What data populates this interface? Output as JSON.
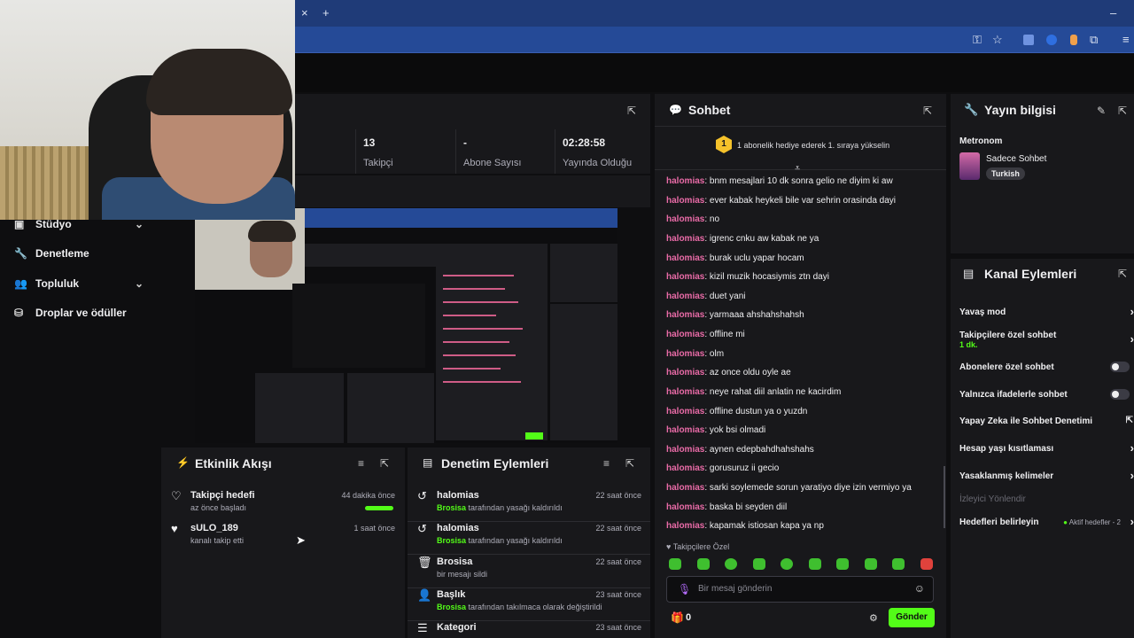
{
  "browser": {
    "close_tab": "×",
    "new_tab": "+",
    "minimize": "–"
  },
  "sidebar": {
    "items": [
      {
        "label": "Stüdyo",
        "icon": "studio-icon",
        "has_chevron": true
      },
      {
        "label": "Denetleme",
        "icon": "wrench-icon",
        "has_chevron": false
      },
      {
        "label": "Topluluk",
        "icon": "people-icon",
        "has_chevron": true
      },
      {
        "label": "Droplar ve ödüller",
        "icon": "drops-icon",
        "has_chevron": false
      }
    ]
  },
  "stats": [
    {
      "value": "13",
      "label": "Takipçi"
    },
    {
      "value": "-",
      "label": "Abone Sayısı"
    },
    {
      "value": "02:28:58",
      "label": "Yayında Olduğu"
    }
  ],
  "activity": {
    "title": "Etkinlik Akışı",
    "items": [
      {
        "title": "Takipçi hedefi",
        "sub": "az önce başladı",
        "time": "44 dakika önce",
        "icon": "heart-outline-icon"
      },
      {
        "title": "sULO_189",
        "sub": "kanalı takip etti",
        "time": "1 saat önce",
        "icon": "heart-icon"
      }
    ]
  },
  "moderation": {
    "title": "Denetim Eylemleri",
    "items": [
      {
        "title": "halomias",
        "actor": "Brosisa",
        "rest": "tarafından yasağı kaldırıldı",
        "time": "22 saat önce",
        "icon": "undo-icon"
      },
      {
        "title": "halomias",
        "actor": "Brosisa",
        "rest": "tarafından yasağı kaldırıldı",
        "time": "22 saat önce",
        "icon": "undo-icon"
      },
      {
        "title": "Brosisa",
        "actor": "",
        "rest": "bir mesajı sildi",
        "time": "22 saat önce",
        "icon": "trash-icon"
      },
      {
        "title": "Başlık",
        "actor": "Brosisa",
        "rest": "tarafından takılmaca olarak değiştirildi",
        "time": "23 saat önce",
        "icon": "user-edit-icon"
      },
      {
        "title": "Kategori",
        "actor": "",
        "rest": "",
        "time": "23 saat önce",
        "icon": "category-icon"
      }
    ]
  },
  "chat": {
    "title": "Sohbet",
    "pinned": "1 abonelik hediye ederek 1. sıraya yükselin",
    "pinned_badge": "1",
    "messages": [
      {
        "user": "halomias",
        "text": ": bnm mesajlari 10 dk sonra gelio ne diyim ki aw"
      },
      {
        "user": "halomias",
        "text": ": ever kabak heykeli bile var sehrin orasinda dayi"
      },
      {
        "user": "halomias",
        "text": ": no"
      },
      {
        "user": "halomias",
        "text": ": igrenc cnku aw kabak ne ya"
      },
      {
        "user": "halomias",
        "text": ": burak uclu yapar hocam"
      },
      {
        "user": "halomias",
        "text": ": kizil muzik hocasiymis ztn dayi"
      },
      {
        "user": "halomias",
        "text": ": duet yani"
      },
      {
        "user": "halomias",
        "text": ": yarmaaa ahshahshahsh"
      },
      {
        "user": "halomias",
        "text": ": offline mi"
      },
      {
        "user": "halomias",
        "text": ": olm"
      },
      {
        "user": "halomias",
        "text": ": az once oldu oyle ae"
      },
      {
        "user": "halomias",
        "text": ": neye rahat diil anlatin ne kacirdim"
      },
      {
        "user": "halomias",
        "text": ": offline dustun ya o yuzdn"
      },
      {
        "user": "halomias",
        "text": ": yok bsi olmadi"
      },
      {
        "user": "halomias",
        "text": ": aynen edepbahdhahshahs"
      },
      {
        "user": "halomias",
        "text": ": gorusuruz ii gecio"
      },
      {
        "user": "halomias",
        "text": ": sarki soylemede sorun yaratiyo diye izin vermiyo ya"
      },
      {
        "user": "halomias",
        "text": ": baska bi seyden diil"
      },
      {
        "user": "halomias",
        "text": ": kapamak istiosan kapa ya np"
      }
    ],
    "followers_only": "Takipçilere Özel",
    "input_placeholder": "Bir mesaj gönderin",
    "points": "0",
    "send_label": "Gönder"
  },
  "stream_info": {
    "title": "Yayın bilgisi",
    "stream_title": "Metronom",
    "category": "Sadece Sohbet",
    "tag": "Turkish"
  },
  "channel_actions": {
    "title": "Kanal Eylemleri",
    "items": [
      {
        "label": "Yavaş mod",
        "sub": "",
        "control": "chevron",
        "enabled": true
      },
      {
        "label": "Takipçilere özel sohbet",
        "sub": "1 dk.",
        "control": "chevron",
        "enabled": true
      },
      {
        "label": "Abonelere özel sohbet",
        "sub": "",
        "control": "toggle",
        "enabled": true
      },
      {
        "label": "Yalnızca ifadelerle sohbet",
        "sub": "",
        "control": "toggle",
        "enabled": true
      },
      {
        "label": "Yapay Zeka ile Sohbet Denetimi",
        "sub": "",
        "control": "popout",
        "enabled": true
      },
      {
        "label": "Hesap yaşı kısıtlaması",
        "sub": "",
        "control": "chevron",
        "enabled": true
      },
      {
        "label": "Yasaklanmış kelimeler",
        "sub": "",
        "control": "chevron",
        "enabled": true
      },
      {
        "label": "İzleyici Yönlendir",
        "sub": "",
        "control": "none",
        "enabled": false
      },
      {
        "label": "Hedefleri belirleyin",
        "sub": "",
        "control": "chevron",
        "enabled": true,
        "status": "Aktif hedefler - 2"
      }
    ]
  },
  "colors": {
    "accent": "#53fc18",
    "username": "#e96ba7",
    "panel": "#18181b",
    "background": "#0e0e10"
  }
}
